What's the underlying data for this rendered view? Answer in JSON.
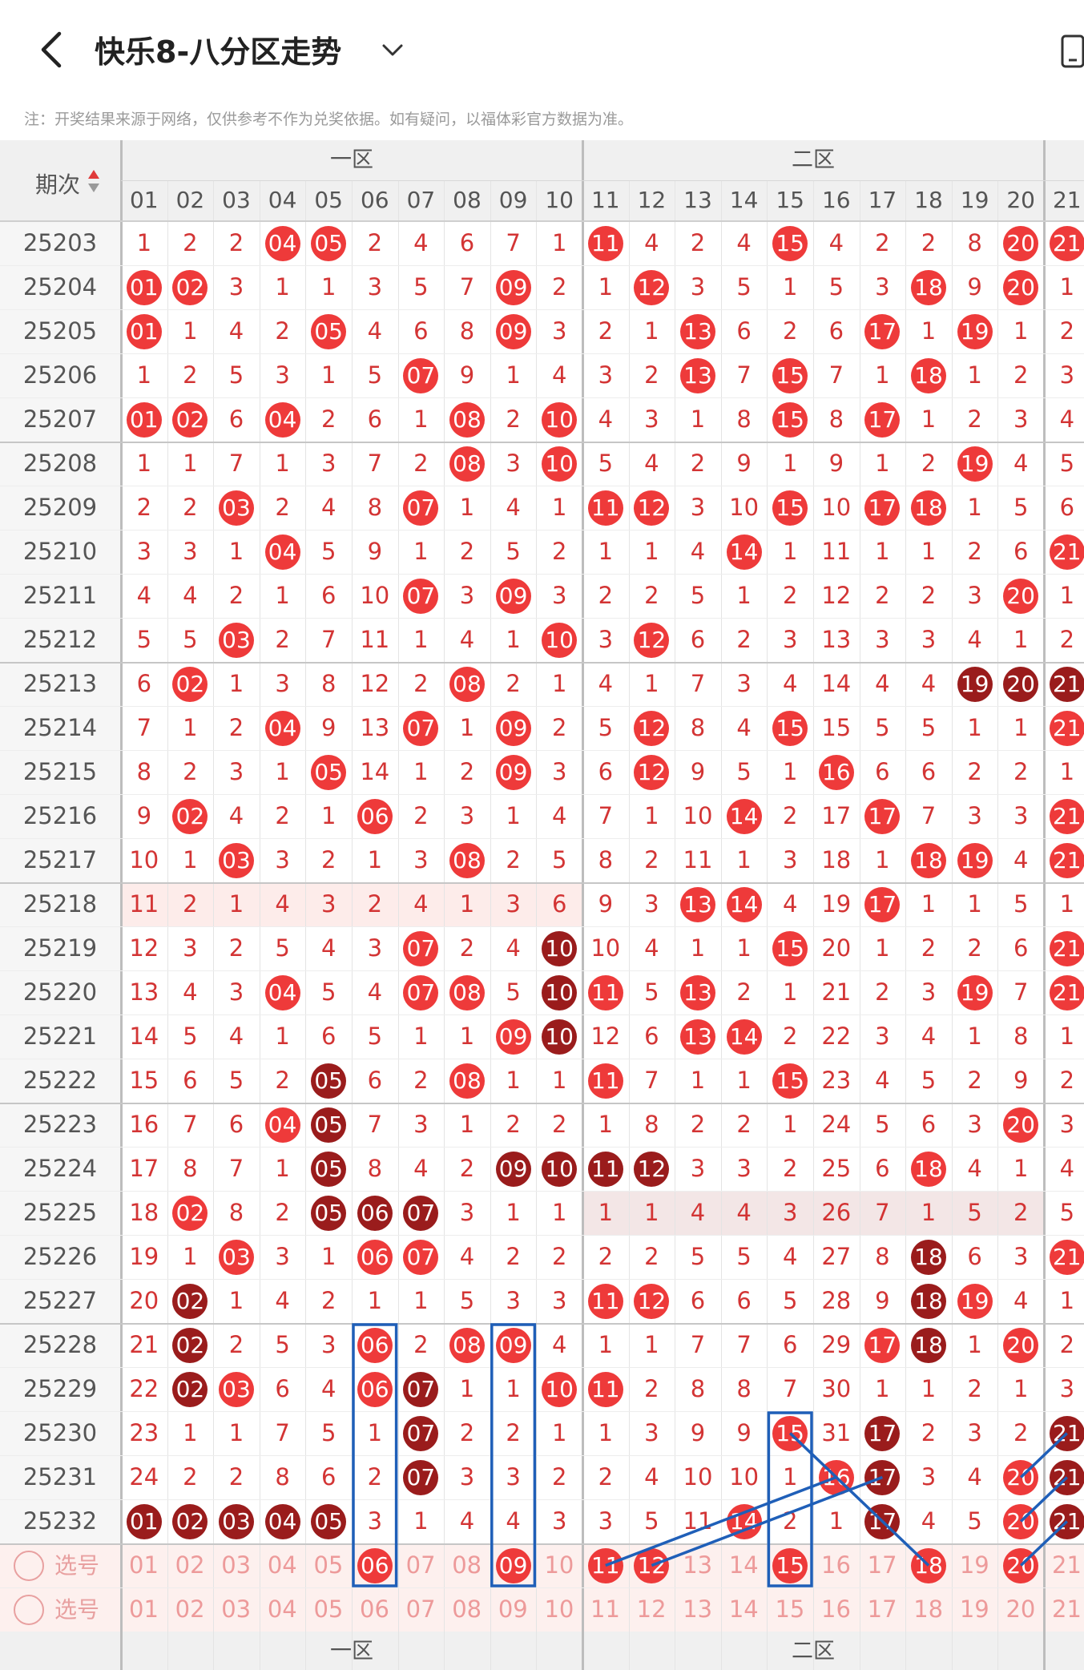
{
  "header": {
    "title": "快乐8-八分区走势",
    "notice": "注：开奖结果来源于网络，仅供参考不作为兑奖依据。如有疑问，以福体彩官方数据为准。"
  },
  "table": {
    "issue_header": "期次",
    "zones": [
      "一区",
      "二区"
    ],
    "columns": [
      "01",
      "02",
      "03",
      "04",
      "05",
      "06",
      "07",
      "08",
      "09",
      "10",
      "11",
      "12",
      "13",
      "14",
      "15",
      "16",
      "17",
      "18",
      "19",
      "20",
      "21"
    ],
    "rows": [
      [
        "25203",
        "1",
        "2",
        "2",
        "04",
        "05",
        "2",
        "4",
        "6",
        "7",
        "1",
        "11",
        "4",
        "2",
        "4",
        "15",
        "4",
        "2",
        "2",
        "8",
        "20",
        "21"
      ],
      [
        "25204",
        "01",
        "02",
        "3",
        "1",
        "1",
        "3",
        "5",
        "7",
        "09",
        "2",
        "1",
        "12",
        "3",
        "5",
        "1",
        "5",
        "3",
        "18",
        "9",
        "20",
        "1"
      ],
      [
        "25205",
        "01",
        "1",
        "4",
        "2",
        "05",
        "4",
        "6",
        "8",
        "09",
        "3",
        "2",
        "1",
        "13",
        "6",
        "2",
        "6",
        "17",
        "1",
        "19",
        "1",
        "2"
      ],
      [
        "25206",
        "1",
        "2",
        "5",
        "3",
        "1",
        "5",
        "07",
        "9",
        "1",
        "4",
        "3",
        "2",
        "13",
        "7",
        "15",
        "7",
        "1",
        "18",
        "1",
        "2",
        "3"
      ],
      [
        "25207",
        "01",
        "02",
        "6",
        "04",
        "2",
        "6",
        "1",
        "08",
        "2",
        "10",
        "4",
        "3",
        "1",
        "8",
        "15",
        "8",
        "17",
        "1",
        "2",
        "3",
        "4"
      ],
      [
        "25208",
        "1",
        "1",
        "7",
        "1",
        "3",
        "7",
        "2",
        "08",
        "3",
        "10",
        "5",
        "4",
        "2",
        "9",
        "1",
        "9",
        "1",
        "2",
        "19",
        "4",
        "5"
      ],
      [
        "25209",
        "2",
        "2",
        "03",
        "2",
        "4",
        "8",
        "07",
        "1",
        "4",
        "1",
        "11",
        "12",
        "3",
        "10",
        "15",
        "10",
        "17",
        "18",
        "1",
        "5",
        "6"
      ],
      [
        "25210",
        "3",
        "3",
        "1",
        "04",
        "5",
        "9",
        "1",
        "2",
        "5",
        "2",
        "1",
        "1",
        "4",
        "14",
        "1",
        "11",
        "1",
        "1",
        "2",
        "6",
        "21"
      ],
      [
        "25211",
        "4",
        "4",
        "2",
        "1",
        "6",
        "10",
        "07",
        "3",
        "09",
        "3",
        "2",
        "2",
        "5",
        "1",
        "2",
        "12",
        "2",
        "2",
        "3",
        "20",
        "1"
      ],
      [
        "25212",
        "5",
        "5",
        "03",
        "2",
        "7",
        "11",
        "1",
        "4",
        "1",
        "10",
        "3",
        "12",
        "6",
        "2",
        "3",
        "13",
        "3",
        "3",
        "4",
        "1",
        "2"
      ],
      [
        "25213",
        "6",
        "02",
        "1",
        "3",
        "8",
        "12",
        "2",
        "08",
        "2",
        "1",
        "4",
        "1",
        "7",
        "3",
        "4",
        "14",
        "4",
        "4",
        "19",
        "20",
        "21"
      ],
      [
        "25214",
        "7",
        "1",
        "2",
        "04",
        "9",
        "13",
        "07",
        "1",
        "09",
        "2",
        "5",
        "12",
        "8",
        "4",
        "15",
        "15",
        "5",
        "5",
        "1",
        "1",
        "21"
      ],
      [
        "25215",
        "8",
        "2",
        "3",
        "1",
        "05",
        "14",
        "1",
        "2",
        "09",
        "3",
        "6",
        "12",
        "9",
        "5",
        "1",
        "16",
        "6",
        "6",
        "2",
        "2",
        "1"
      ],
      [
        "25216",
        "9",
        "02",
        "4",
        "2",
        "1",
        "06",
        "2",
        "3",
        "1",
        "4",
        "7",
        "1",
        "10",
        "14",
        "2",
        "17",
        "17",
        "7",
        "3",
        "3",
        "21"
      ],
      [
        "25217",
        "10",
        "1",
        "03",
        "3",
        "2",
        "1",
        "3",
        "08",
        "2",
        "5",
        "8",
        "2",
        "11",
        "1",
        "3",
        "18",
        "1",
        "18",
        "19",
        "4",
        "21"
      ],
      [
        "25218",
        "11",
        "2",
        "1",
        "4",
        "3",
        "2",
        "4",
        "1",
        "3",
        "6",
        "9",
        "3",
        "13",
        "14",
        "4",
        "19",
        "17",
        "1",
        "1",
        "5",
        "1"
      ],
      [
        "25219",
        "12",
        "3",
        "2",
        "5",
        "4",
        "3",
        "07",
        "2",
        "4",
        "10",
        "10",
        "4",
        "1",
        "1",
        "15",
        "20",
        "1",
        "2",
        "2",
        "6",
        "21"
      ],
      [
        "25220",
        "13",
        "4",
        "3",
        "04",
        "5",
        "4",
        "07",
        "08",
        "5",
        "10",
        "11",
        "5",
        "13",
        "2",
        "1",
        "21",
        "2",
        "3",
        "19",
        "7",
        "21"
      ],
      [
        "25221",
        "14",
        "5",
        "4",
        "1",
        "6",
        "5",
        "1",
        "1",
        "09",
        "10",
        "12",
        "6",
        "13",
        "14",
        "2",
        "22",
        "3",
        "4",
        "1",
        "8",
        "1"
      ],
      [
        "25222",
        "15",
        "6",
        "5",
        "2",
        "05",
        "6",
        "2",
        "08",
        "1",
        "1",
        "11",
        "7",
        "1",
        "1",
        "15",
        "23",
        "4",
        "5",
        "2",
        "9",
        "2"
      ],
      [
        "25223",
        "16",
        "7",
        "6",
        "04",
        "05",
        "7",
        "3",
        "1",
        "2",
        "2",
        "1",
        "8",
        "2",
        "2",
        "1",
        "24",
        "5",
        "6",
        "3",
        "20",
        "3"
      ],
      [
        "25224",
        "17",
        "8",
        "7",
        "1",
        "05",
        "8",
        "4",
        "2",
        "09",
        "10",
        "11",
        "12",
        "3",
        "3",
        "2",
        "25",
        "6",
        "18",
        "4",
        "1",
        "4"
      ],
      [
        "25225",
        "18",
        "02",
        "8",
        "2",
        "05",
        "06",
        "07",
        "3",
        "1",
        "1",
        "1",
        "1",
        "4",
        "4",
        "3",
        "26",
        "7",
        "1",
        "5",
        "2",
        "5"
      ],
      [
        "25226",
        "19",
        "1",
        "03",
        "3",
        "1",
        "06",
        "07",
        "4",
        "2",
        "2",
        "2",
        "2",
        "5",
        "5",
        "4",
        "27",
        "8",
        "18",
        "6",
        "3",
        "21"
      ],
      [
        "25227",
        "20",
        "02",
        "1",
        "4",
        "2",
        "1",
        "1",
        "5",
        "3",
        "3",
        "11",
        "12",
        "6",
        "6",
        "5",
        "28",
        "9",
        "18",
        "19",
        "4",
        "1"
      ],
      [
        "25228",
        "21",
        "02",
        "2",
        "5",
        "3",
        "06",
        "2",
        "08",
        "09",
        "4",
        "1",
        "1",
        "7",
        "7",
        "6",
        "29",
        "17",
        "18",
        "1",
        "20",
        "2"
      ],
      [
        "25229",
        "22",
        "02",
        "03",
        "6",
        "4",
        "06",
        "07",
        "1",
        "1",
        "10",
        "11",
        "2",
        "8",
        "8",
        "7",
        "30",
        "1",
        "1",
        "2",
        "1",
        "3"
      ],
      [
        "25230",
        "23",
        "1",
        "1",
        "7",
        "5",
        "1",
        "07",
        "2",
        "2",
        "1",
        "1",
        "3",
        "9",
        "9",
        "15",
        "31",
        "17",
        "2",
        "3",
        "2",
        "21"
      ],
      [
        "25231",
        "24",
        "2",
        "2",
        "8",
        "6",
        "2",
        "07",
        "3",
        "3",
        "2",
        "2",
        "4",
        "10",
        "10",
        "1",
        "16",
        "17",
        "3",
        "4",
        "20",
        "21"
      ],
      [
        "25232",
        "01",
        "02",
        "03",
        "04",
        "05",
        "3",
        "1",
        "4",
        "4",
        "3",
        "3",
        "5",
        "11",
        "14",
        "2",
        "1",
        "17",
        "4",
        "5",
        "20",
        "21"
      ]
    ],
    "dark_balls": [
      "25213-19",
      "25213-20",
      "25213-21",
      "25219-10",
      "25220-10",
      "25221-10",
      "25222-05",
      "25223-05",
      "25224-05",
      "25224-09",
      "25224-10",
      "25224-11",
      "25224-12",
      "25225-05",
      "25225-06",
      "25225-07",
      "25226-18",
      "25227-02",
      "25227-18",
      "25228-02",
      "25228-18",
      "25229-02",
      "25229-07",
      "25230-07",
      "25230-17",
      "25230-21",
      "25231-07",
      "25231-17",
      "25231-21",
      "25232-01",
      "25232-02",
      "25232-03",
      "25232-04",
      "25232-05",
      "25232-17",
      "25232-21"
    ],
    "pick_label": "选号",
    "pick_rows": [
      {
        "selected": [
          "06",
          "09",
          "11",
          "12",
          "15",
          "18",
          "20"
        ]
      },
      {
        "selected": []
      }
    ],
    "colors": {
      "ball_red": "#ee3a3a",
      "ball_dark": "#9a1c1c",
      "number_red": "#d33434",
      "highlight_box": "#1f5fb8",
      "pick_bg": "#fdf0ee"
    }
  }
}
